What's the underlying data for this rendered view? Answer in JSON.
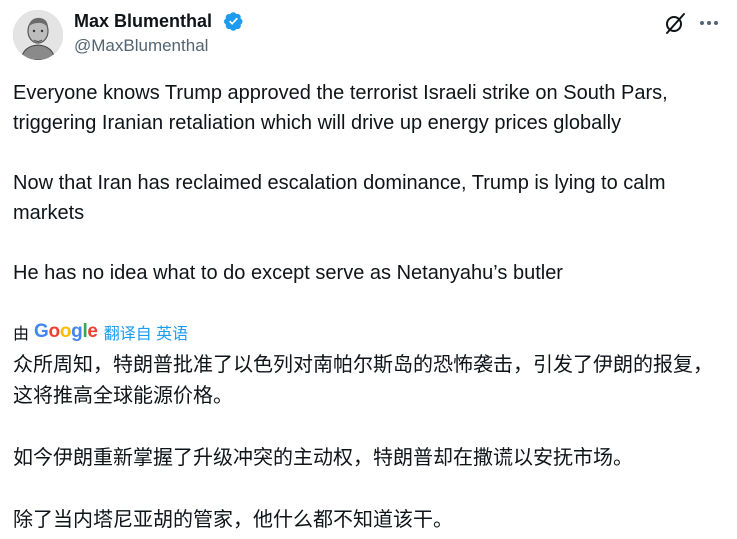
{
  "author": {
    "display_name": "Max Blumenthal",
    "handle": "@MaxBlumenthal",
    "verified": true,
    "verified_color": "#1d9bf0",
    "avatar_icon": "avatar-portrait"
  },
  "actions": {
    "grok_icon": "grok-icon",
    "more_icon": "more-icon"
  },
  "tweet": {
    "paragraphs": [
      "Everyone knows Trump approved the terrorist Israeli strike on South Pars, triggering Iranian retaliation which will drive up energy prices globally",
      "Now that Iran has reclaimed escalation dominance, Trump is lying to calm markets",
      "He has no idea what to do except serve as Netanyahu’s butler"
    ]
  },
  "translation": {
    "by": "由",
    "provider_letters": [
      "G",
      "o",
      "o",
      "g",
      "l",
      "e"
    ],
    "link_text": "翻译自 英语",
    "link_color": "#1d9bf0",
    "paragraphs": [
      "众所周知，特朗普批准了以色列对南帕尔斯岛的恐怖袭击，引发了伊朗的报复，这将推高全球能源价格。",
      "如今伊朗重新掌握了升级冲突的主动权，特朗普却在撒谎以安抚市场。",
      "除了当内塔尼亚胡的管家，他什么都不知道该干。"
    ]
  }
}
